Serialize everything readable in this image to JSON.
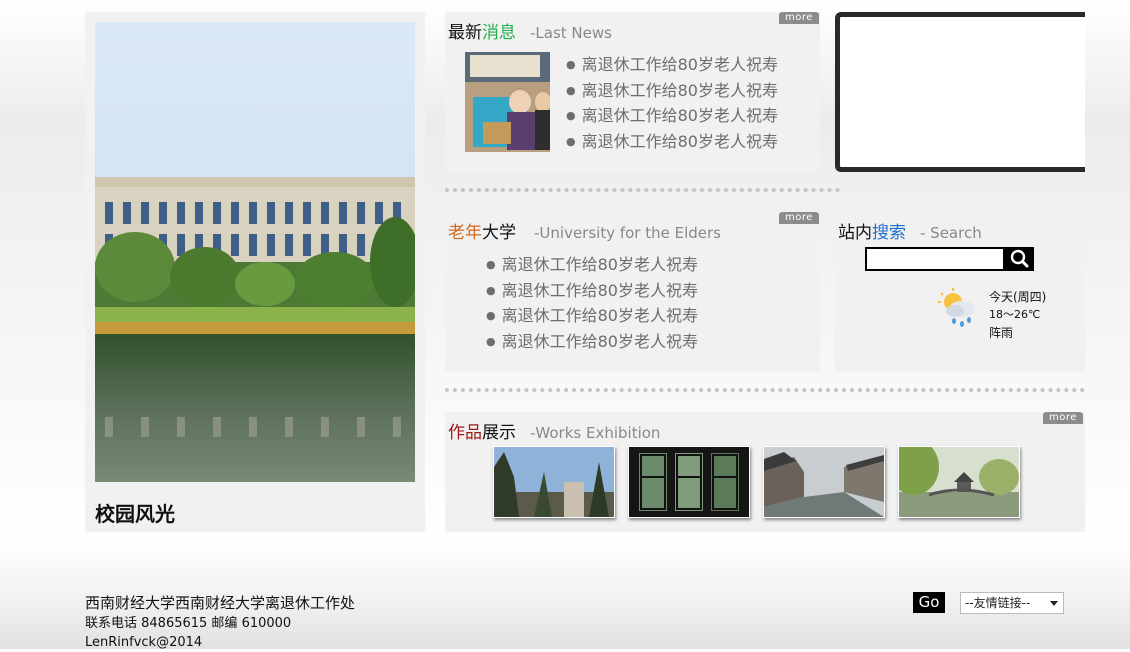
{
  "campus": {
    "title": "校园风光"
  },
  "news": {
    "title_a": "最新",
    "title_b": "消息",
    "subtitle": "-Last News",
    "more": "more",
    "items": [
      "离退休工作给80岁老人祝寿",
      "离退休工作给80岁老人祝寿",
      "离退休工作给80岁老人祝寿",
      "离退休工作给80岁老人祝寿"
    ]
  },
  "elders": {
    "title_a": "老年",
    "title_b": "大学",
    "subtitle": "-University for the Elders",
    "more": "more",
    "items": [
      "离退休工作给80岁老人祝寿",
      "离退休工作给80岁老人祝寿",
      "离退休工作给80岁老人祝寿",
      "离退休工作给80岁老人祝寿"
    ]
  },
  "search": {
    "title_a": "站内",
    "title_b": "搜索",
    "subtitle": "- Search",
    "input_value": "",
    "icon": "magnifier-icon"
  },
  "weather": {
    "icon": "rain-cloud-sun-icon",
    "day": "今天(周四)",
    "temp": "18～26℃",
    "condition": "阵雨"
  },
  "works": {
    "title_a": "作品",
    "title_b": "展示",
    "subtitle": "-Works Exhibition",
    "more": "more"
  },
  "footer": {
    "org": "西南财经大学西南财经大学离退休工作处",
    "contact": "联系电话 84865615  邮编 610000",
    "copyright": "LenRinfvck@2014",
    "go": "Go",
    "links_selected": "--友情链接--"
  },
  "colors": {
    "accent_green": "#22b14c",
    "accent_orange": "#d2691e",
    "accent_blue": "#1e6fd0",
    "accent_red": "#a01818"
  }
}
